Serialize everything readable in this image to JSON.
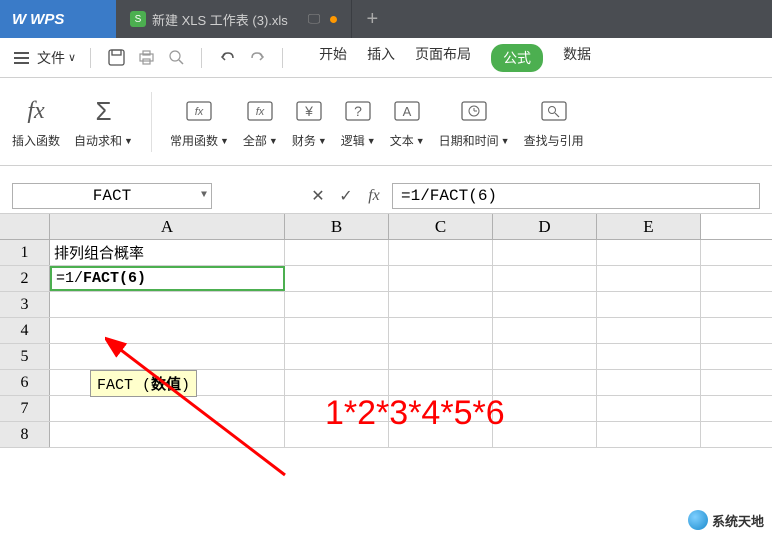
{
  "app_name": "WPS",
  "tab_title": "新建 XLS 工作表 (3).xls",
  "menu": {
    "file": "文件",
    "tabs": [
      "开始",
      "插入",
      "页面布局",
      "公式",
      "数据"
    ],
    "active_tab": "公式"
  },
  "ribbon": {
    "items": [
      {
        "label": "插入函数",
        "icon": "fx"
      },
      {
        "label": "自动求和",
        "icon": "sum",
        "dd": true
      },
      {
        "label": "常用函数",
        "icon": "fx-star",
        "dd": true
      },
      {
        "label": "全部",
        "icon": "fx-box",
        "dd": true
      },
      {
        "label": "财务",
        "icon": "yen",
        "dd": true
      },
      {
        "label": "逻辑",
        "icon": "question",
        "dd": true
      },
      {
        "label": "文本",
        "icon": "text",
        "dd": true
      },
      {
        "label": "日期和时间",
        "icon": "clock",
        "dd": true
      },
      {
        "label": "查找与引用",
        "icon": "search",
        "dd": true
      }
    ]
  },
  "formula_bar": {
    "name_box": "FACT",
    "formula": "=1/FACT(6)"
  },
  "columns": [
    "A",
    "B",
    "C",
    "D",
    "E"
  ],
  "rows": [
    "1",
    "2",
    "3",
    "4",
    "5",
    "6",
    "7",
    "8"
  ],
  "cells": {
    "A1": "排列组合概率",
    "A2_prefix": "=1/",
    "A2_func": "FACT(6)"
  },
  "tooltip": {
    "func": "FACT",
    "arg": "数值"
  },
  "annotation": "1*2*3*4*5*6",
  "watermark": "系统天地"
}
